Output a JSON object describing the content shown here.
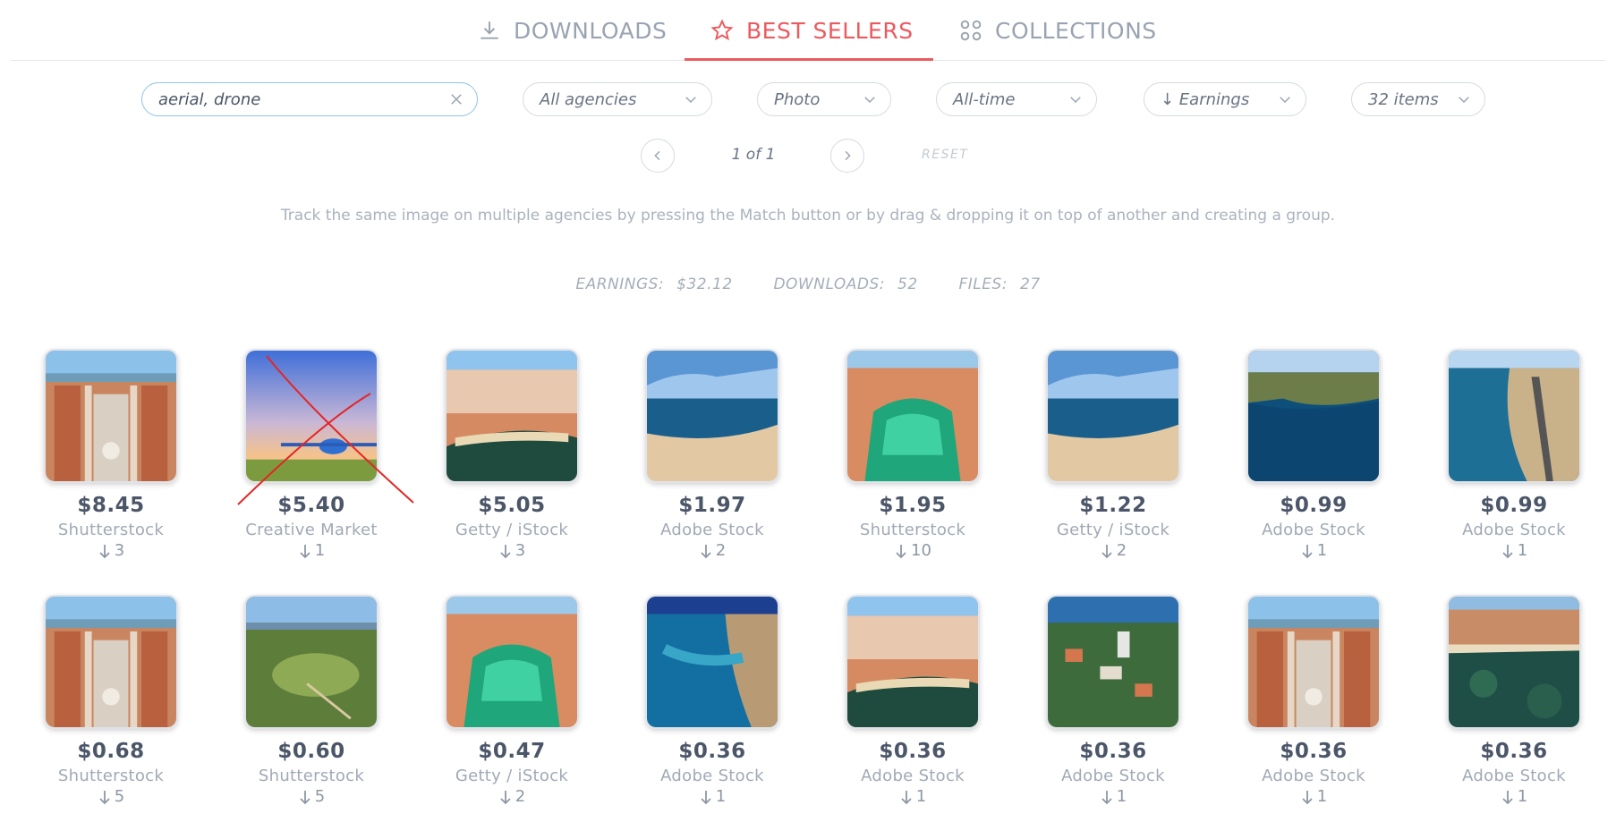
{
  "tabs": [
    {
      "label": "DOWNLOADS",
      "icon": "download-icon"
    },
    {
      "label": "BEST SELLERS",
      "icon": "star-icon",
      "active": true
    },
    {
      "label": "COLLECTIONS",
      "icon": "grid-circles-icon"
    }
  ],
  "filters": {
    "search_value": "aerial, drone",
    "agency": "All agencies",
    "type": "Photo",
    "period": "All-time",
    "sort": "↓ Earnings",
    "items": "32 items"
  },
  "pagination": {
    "text": "1 of 1",
    "reset": "RESET"
  },
  "hint": "Track the same image on multiple agencies by pressing the Match button or by drag & dropping it on top of another and creating a group.",
  "stats": {
    "earnings_label": "EARNINGS:",
    "earnings": "$32.12",
    "downloads_label": "DOWNLOADS:",
    "downloads": "52",
    "files_label": "FILES:",
    "files": "27"
  },
  "colors": {
    "accent": "#ec5a5f",
    "search_border": "#8fc3e8"
  },
  "items": [
    {
      "price": "$8.45",
      "agency": "Shutterstock",
      "downloads": "3",
      "thumb": "city"
    },
    {
      "price": "$5.40",
      "agency": "Creative Market",
      "downloads": "1",
      "thumb": "plane"
    },
    {
      "price": "$5.05",
      "agency": "Getty / iStock",
      "downloads": "3",
      "thumb": "cove"
    },
    {
      "price": "$1.97",
      "agency": "Adobe Stock",
      "downloads": "2",
      "thumb": "beach"
    },
    {
      "price": "$1.95",
      "agency": "Shutterstock",
      "downloads": "10",
      "thumb": "cove-green"
    },
    {
      "price": "$1.22",
      "agency": "Getty / iStock",
      "downloads": "2",
      "thumb": "beach"
    },
    {
      "price": "$0.99",
      "agency": "Adobe Stock",
      "downloads": "1",
      "thumb": "cliff-sea"
    },
    {
      "price": "$0.99",
      "agency": "Adobe Stock",
      "downloads": "1",
      "thumb": "coast-road"
    },
    {
      "price": "$0.68",
      "agency": "Shutterstock",
      "downloads": "5",
      "thumb": "city"
    },
    {
      "price": "$0.60",
      "agency": "Shutterstock",
      "downloads": "5",
      "thumb": "golf"
    },
    {
      "price": "$0.47",
      "agency": "Getty / iStock",
      "downloads": "2",
      "thumb": "cove-green"
    },
    {
      "price": "$0.36",
      "agency": "Adobe Stock",
      "downloads": "1",
      "thumb": "deep-sea"
    },
    {
      "price": "$0.36",
      "agency": "Adobe Stock",
      "downloads": "1",
      "thumb": "cove"
    },
    {
      "price": "$0.36",
      "agency": "Adobe Stock",
      "downloads": "1",
      "thumb": "town-trees"
    },
    {
      "price": "$0.36",
      "agency": "Adobe Stock",
      "downloads": "1",
      "thumb": "city"
    },
    {
      "price": "$0.36",
      "agency": "Adobe Stock",
      "downloads": "1",
      "thumb": "reef-town"
    }
  ]
}
